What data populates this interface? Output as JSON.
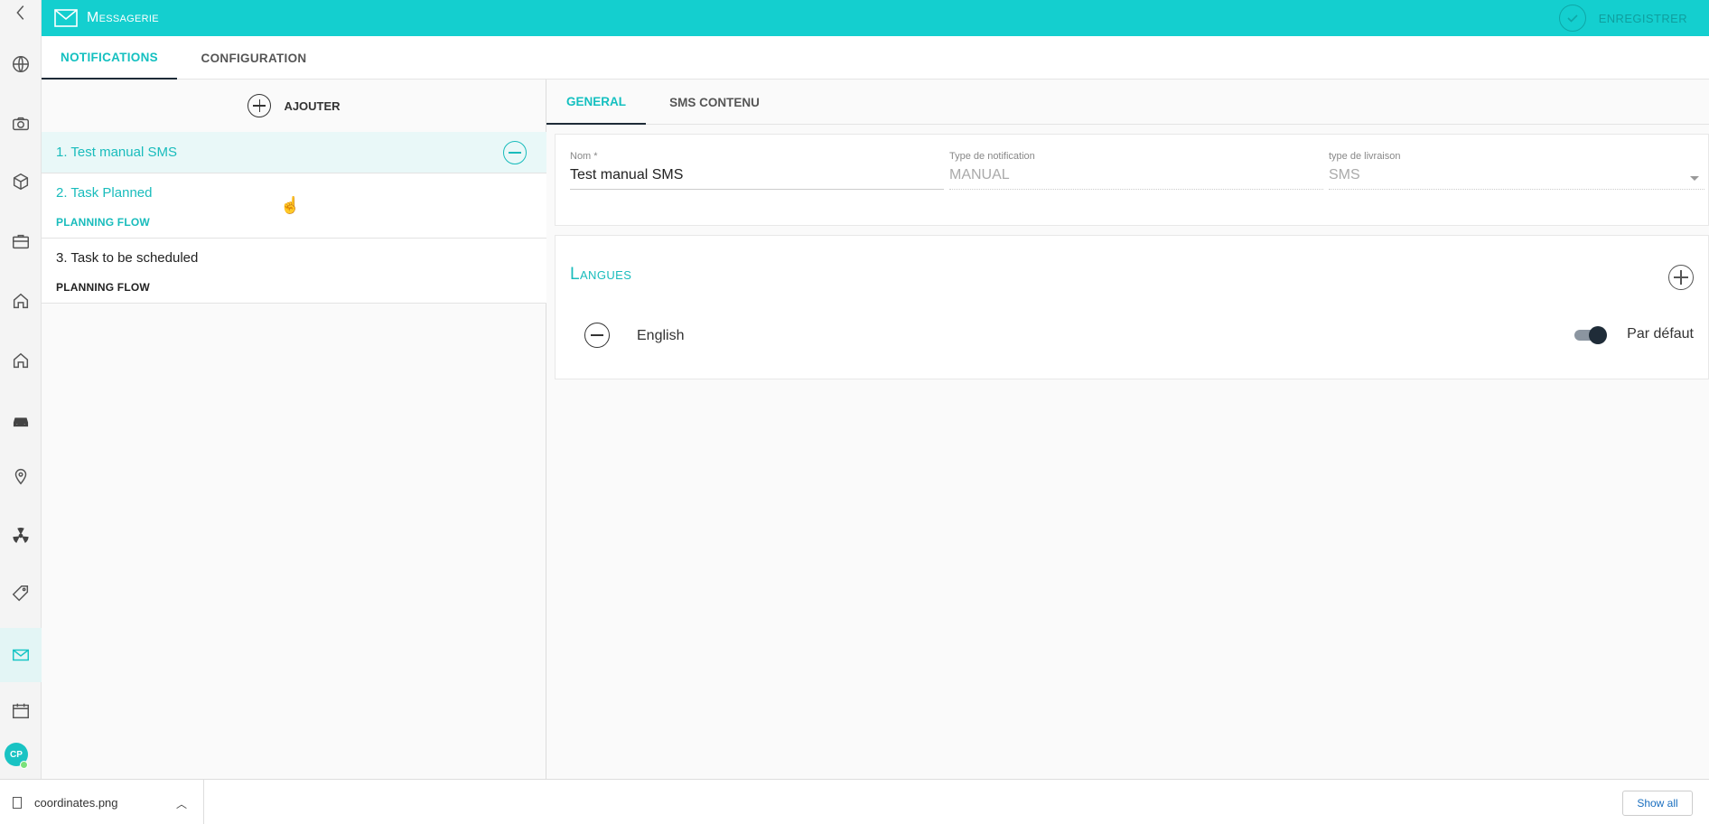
{
  "app": {
    "title": "Messagerie",
    "save_label": "ENREGISTRER",
    "accent": "#14cfcf"
  },
  "rail": {
    "icons": [
      "back-arrow-icon",
      "globe-icon",
      "camera-icon",
      "cube-icon",
      "briefcase-icon",
      "home-icon",
      "home-outline-icon",
      "car-icon",
      "map-pin-icon",
      "radiation-icon",
      "tag-icon",
      "mail-icon",
      "calendar-icon"
    ],
    "avatar_initials": "CP"
  },
  "main_tabs": [
    "NOTIFICATIONS",
    "CONFIGURATION"
  ],
  "left": {
    "add_label": "AJOUTER",
    "items": [
      {
        "title": "1. Test manual SMS",
        "subtitle": ""
      },
      {
        "title": "2. Task Planned",
        "subtitle": "PLANNING FLOW"
      },
      {
        "title": "3. Task to be scheduled",
        "subtitle": "PLANNING FLOW"
      }
    ]
  },
  "right": {
    "tabs": [
      "GENERAL",
      "SMS CONTENU"
    ],
    "form": {
      "nom_label": "Nom *",
      "nom_value": "Test manual SMS",
      "type_label": "Type de notification",
      "type_value": "MANUAL",
      "livraison_label": "type de livraison",
      "livraison_value": "SMS"
    },
    "langues": {
      "title": "Langues",
      "items": [
        {
          "name": "English",
          "default_label": "Par défaut",
          "default_on": true
        }
      ]
    }
  },
  "download_bar": {
    "file_name": "coordinates.png",
    "show_all": "Show all"
  }
}
